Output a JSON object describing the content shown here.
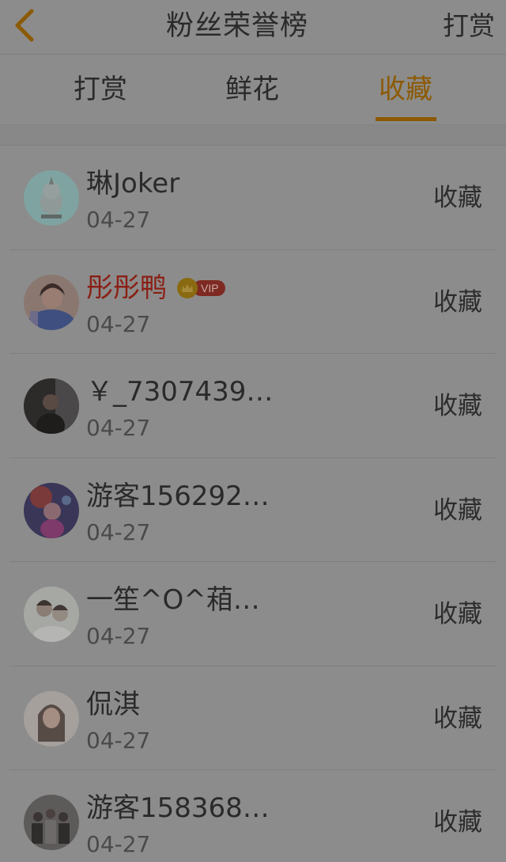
{
  "header": {
    "title": "粉丝荣誉榜",
    "right_label": "打赏"
  },
  "tabs": [
    {
      "label": "打赏",
      "active": false
    },
    {
      "label": "鲜花",
      "active": false
    },
    {
      "label": "收藏",
      "active": true
    }
  ],
  "colors": {
    "accent": "#8c5a04",
    "vip_name": "#8a1f14",
    "text": "#2a2a2a",
    "overlay_background": "#8c8c8c"
  },
  "fans": [
    {
      "name": "琳Joker",
      "date": "04-27",
      "action": "收藏",
      "vip": false,
      "avatar": "unicorn-avatar"
    },
    {
      "name": "彤彤鸭",
      "date": "04-27",
      "action": "收藏",
      "vip": true,
      "vip_label": "VIP",
      "avatar": "girl-blue-avatar"
    },
    {
      "name": "￥_7307439…",
      "date": "04-27",
      "action": "收藏",
      "vip": false,
      "avatar": "dark-photo-avatar"
    },
    {
      "name": "游客156292…",
      "date": "04-27",
      "action": "收藏",
      "vip": false,
      "avatar": "anime-girl-avatar"
    },
    {
      "name": "一笙^O^葙…",
      "date": "04-27",
      "action": "收藏",
      "vip": false,
      "avatar": "couple-avatar"
    },
    {
      "name": "侃淇",
      "date": "04-27",
      "action": "收藏",
      "vip": false,
      "avatar": "woman-portrait-avatar"
    },
    {
      "name": "游客158368…",
      "date": "04-27",
      "action": "收藏",
      "vip": false,
      "avatar": "group-photo-avatar"
    }
  ]
}
